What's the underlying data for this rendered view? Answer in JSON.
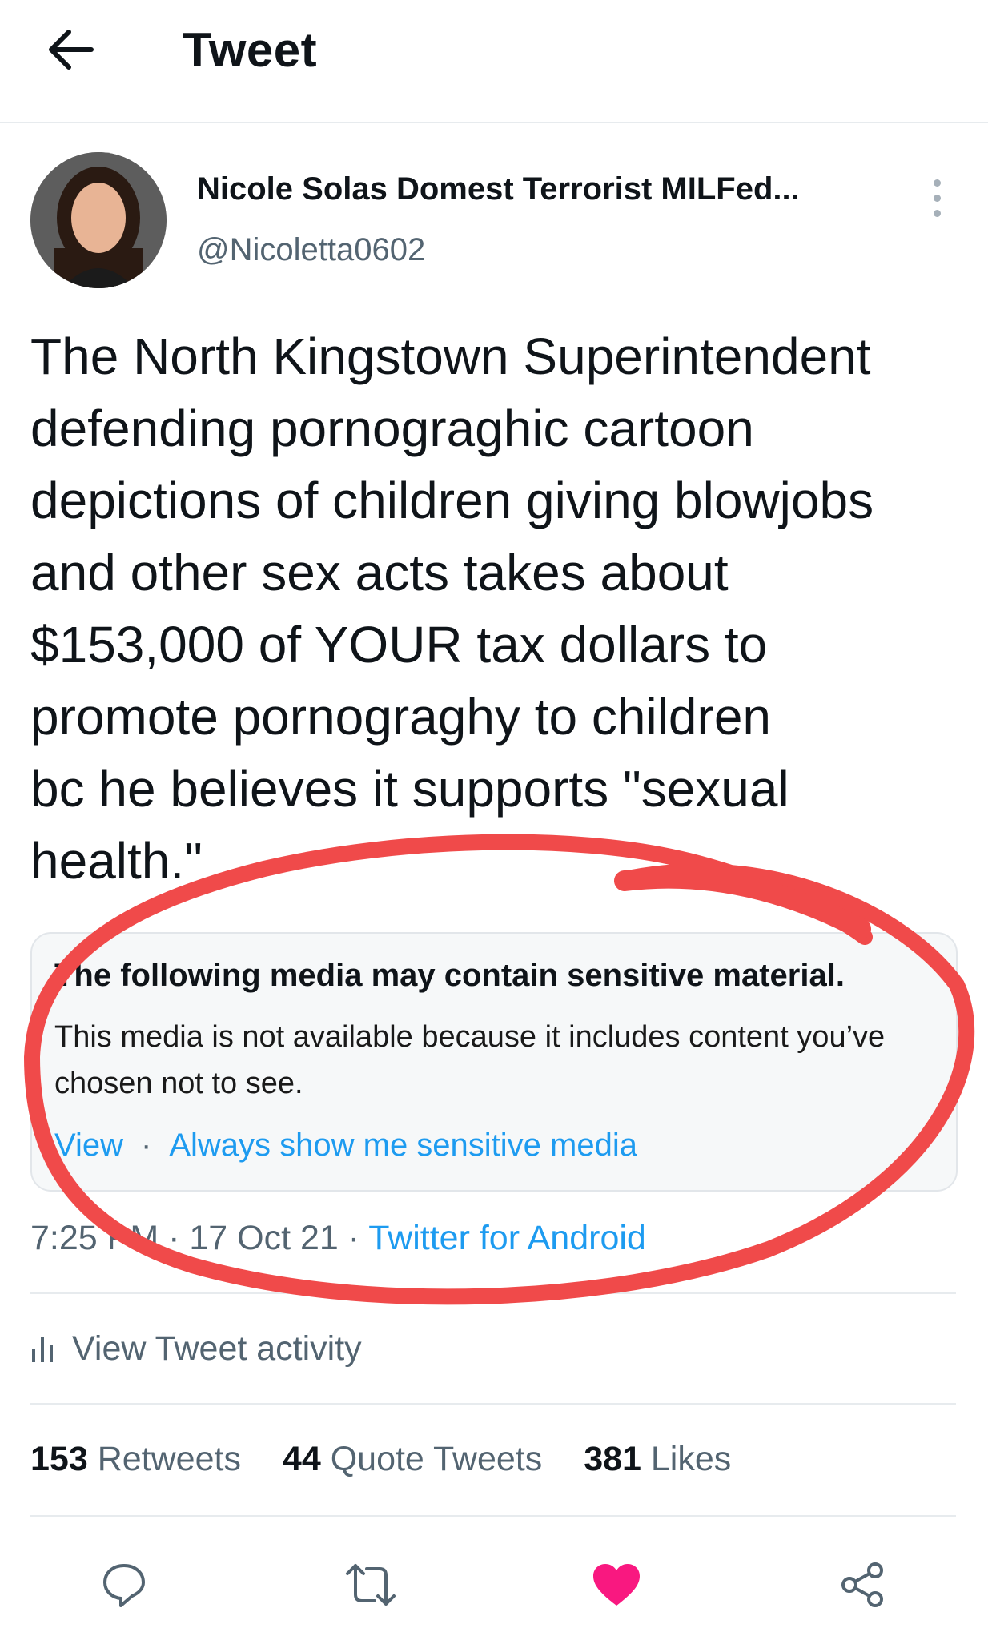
{
  "header": {
    "title": "Tweet"
  },
  "author": {
    "name": "Nicole Solas Domest Terrorist MILFed...",
    "handle": "@Nicoletta0602"
  },
  "tweet": {
    "lines": [
      "The North Kingstown Superintendent",
      "defending pornograghic cartoon",
      "depictions of children giving blowjobs",
      "and other sex acts takes about",
      "$153,000 of YOUR tax dollars to",
      "promote pornograghy to children",
      "bc he believes it supports \"sexual",
      "health.\""
    ]
  },
  "sensitive": {
    "title": "The following media may contain sensitive material.",
    "description": "This media is not available because it includes content you’ve chosen not to see.",
    "view_label": "View",
    "separator": "·",
    "always_show_label": "Always show me sensitive media"
  },
  "meta": {
    "time": "7:25 PM",
    "dot1": "·",
    "date": "17 Oct 21",
    "dot2": "·",
    "source": "Twitter for Android"
  },
  "activity": {
    "label": "View Tweet activity"
  },
  "stats": {
    "retweets_count": "153",
    "retweets_label": "Retweets",
    "quotes_count": "44",
    "quotes_label": "Quote Tweets",
    "likes_count": "381",
    "likes_label": "Likes"
  },
  "colors": {
    "accent": "#1d9bf0",
    "like": "#f91880",
    "annotation": "#f04a4a",
    "muted": "#536471"
  },
  "icons": [
    "back-arrow-icon",
    "more-vertical-icon",
    "activity-bars-icon",
    "reply-icon",
    "retweet-icon",
    "heart-icon",
    "share-icon"
  ]
}
